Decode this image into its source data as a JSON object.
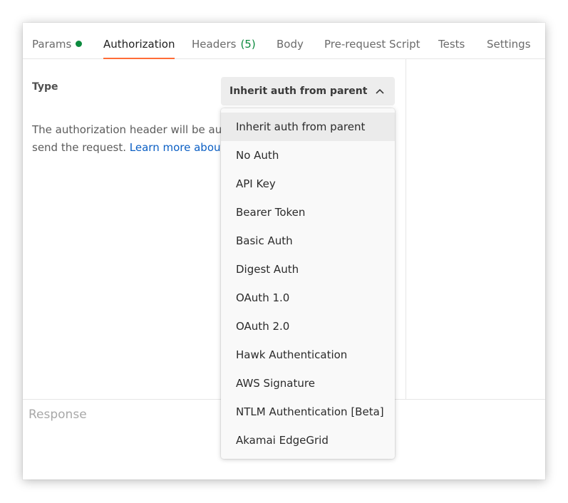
{
  "tabs": [
    {
      "label": "Params",
      "indicator": "green-dot",
      "active": false
    },
    {
      "label": "Authorization",
      "active": true
    },
    {
      "label": "Headers",
      "count": "(5)",
      "active": false
    },
    {
      "label": "Body",
      "active": false
    },
    {
      "label": "Pre-request Script",
      "active": false
    },
    {
      "label": "Tests",
      "active": false
    },
    {
      "label": "Settings",
      "active": false
    }
  ],
  "auth": {
    "type_label": "Type",
    "selected_value": "Inherit auth from parent",
    "description_visible": "The authorization header will be autor",
    "description_line2": "send the request.",
    "learn_more_visible": "Learn more about a"
  },
  "response": {
    "label": "Response"
  },
  "dropdown": {
    "options": [
      "Inherit auth from parent",
      "No Auth",
      "API Key",
      "Bearer Token",
      "Basic Auth",
      "Digest Auth",
      "OAuth 1.0",
      "OAuth 2.0",
      "Hawk Authentication",
      "AWS Signature",
      "NTLM Authentication [Beta]",
      "Akamai EdgeGrid"
    ],
    "selected_index": 0
  },
  "colors": {
    "accent_tab_underline": "#ff6c37",
    "status_green": "#0c8a3e",
    "link_blue": "#0b5fc4"
  },
  "icons": {
    "select_chevron": "chevron-up-icon",
    "params_indicator": "green-dot"
  }
}
